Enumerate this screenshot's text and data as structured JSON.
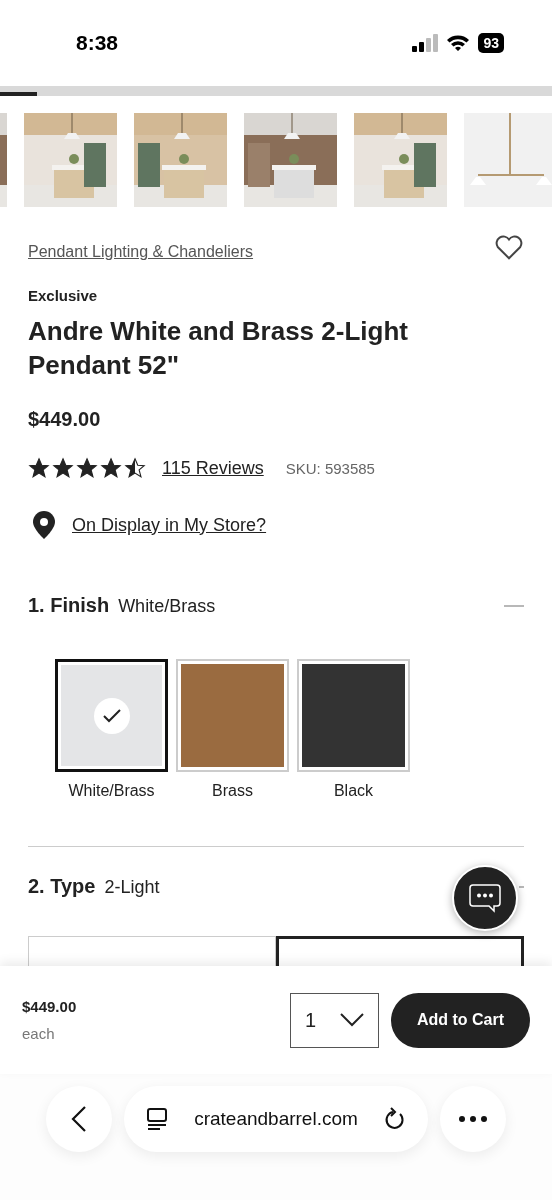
{
  "status_bar": {
    "time": "8:38",
    "battery": "93"
  },
  "product": {
    "breadcrumb": "Pendant Lighting & Chandeliers",
    "favorited": false,
    "badge": "Exclusive",
    "title": "Andre White and Brass 2-Light Pendant 52\"",
    "price": "$449.00",
    "stars": 4.5,
    "reviews": "115 Reviews",
    "sku": "SKU: 593585",
    "store_link": "On Display in My Store?"
  },
  "options": [
    {
      "heading": "1. Finish",
      "value": "White/Brass",
      "expanded": true,
      "swatches": [
        {
          "label": "White/Brass",
          "color": "#e4e5e7",
          "selected": true
        },
        {
          "label": "Brass",
          "color": "#9a6b40",
          "selected": false
        },
        {
          "label": "Black",
          "color": "#333333",
          "selected": false
        }
      ]
    },
    {
      "heading": "2. Type",
      "value": "2-Light",
      "expanded": true,
      "choices": [
        {
          "selected": false
        },
        {
          "selected": true
        }
      ]
    }
  ],
  "cart_bar": {
    "price": "$449.00",
    "unit": "each",
    "quantity": "1",
    "button": "Add to Cart"
  },
  "browser": {
    "url": "crateandbarrel.com"
  }
}
